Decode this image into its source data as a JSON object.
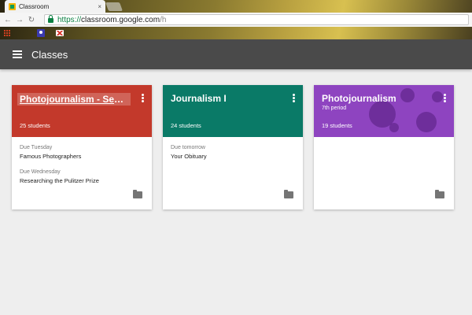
{
  "browser": {
    "tab_title": "Classroom",
    "tab_close": "×",
    "url_https": "https://",
    "url_host": "classroom.google.com",
    "url_path": "/h"
  },
  "appbar": {
    "title": "Classes"
  },
  "colors": {
    "red": "#c3392b",
    "teal": "#0a7a67",
    "purple": "#8e44c0",
    "appbar": "#4a4a4a"
  },
  "classes": [
    {
      "title": "Photojournalism - Secon...",
      "subtitle": "",
      "students": "25 students",
      "assignments": [
        {
          "due": "Due Tuesday",
          "name": "Famous Photographers"
        },
        {
          "due": "Due Wednesday",
          "name": "Researching the Pulitzer Prize"
        }
      ]
    },
    {
      "title": "Journalism I",
      "subtitle": "",
      "students": "24 students",
      "assignments": [
        {
          "due": "Due tomorrow",
          "name": "Your Obituary"
        }
      ]
    },
    {
      "title": "Photojournalism",
      "subtitle": "7th period",
      "students": "19 students",
      "assignments": []
    }
  ],
  "icons": {
    "menu": "hamburger-menu-icon",
    "more": "more-vert-icon",
    "folder": "folder-icon"
  }
}
